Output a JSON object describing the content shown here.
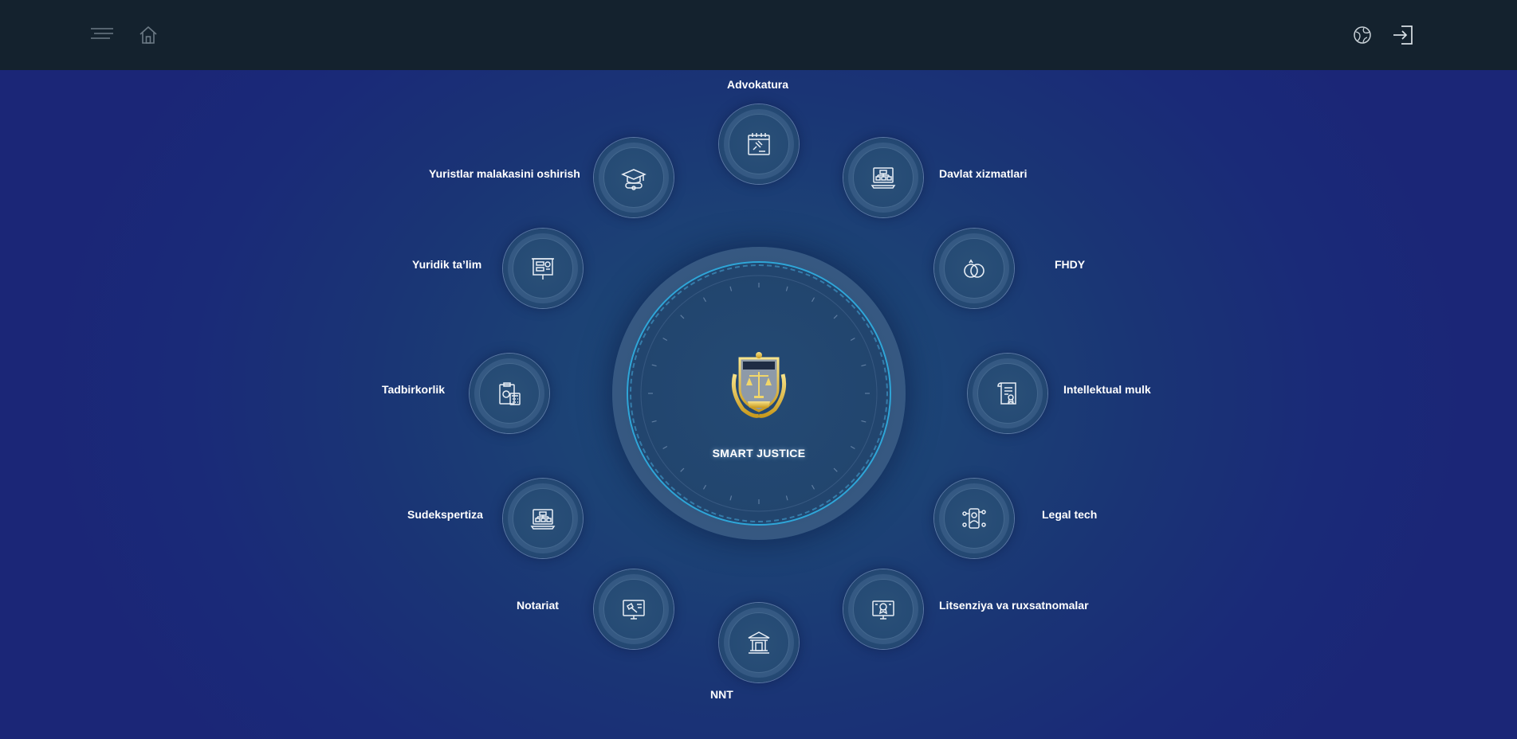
{
  "header": {
    "menu_icon": "hamburger-menu-icon",
    "home_icon": "home-icon",
    "language_icon": "globe-icon",
    "login_icon": "sign-in-icon",
    "background_color": "#14222e"
  },
  "center": {
    "title": "SMART JUSTICE",
    "emblem_icon": "justice-emblem-icon",
    "ring_color": "#2fa6d8"
  },
  "services": [
    {
      "label": "Advokatura",
      "icon": "calendar-gavel-icon"
    },
    {
      "label": "Davlat xizmatlari",
      "icon": "org-chart-laptop-icon"
    },
    {
      "label": "FHDY",
      "icon": "wedding-rings-icon"
    },
    {
      "label": "Intellektual mulk",
      "icon": "certificate-scroll-icon"
    },
    {
      "label": "Legal tech",
      "icon": "phone-network-icon"
    },
    {
      "label": "Litsenziya va ruxsatnomalar",
      "icon": "monitor-badge-icon"
    },
    {
      "label": "NNT",
      "icon": "building-icon"
    },
    {
      "label": "Notariat",
      "icon": "monitor-gavel-icon"
    },
    {
      "label": "Sudekspertiza",
      "icon": "laptop-org-chart-icon"
    },
    {
      "label": "Tadbirkorlik",
      "icon": "clipboard-calculator-icon"
    },
    {
      "label": "Yuridik ta’lim",
      "icon": "presentation-board-icon"
    },
    {
      "label": "Yuristlar malakasini oshirish",
      "icon": "graduation-cap-diploma-icon"
    }
  ],
  "colors": {
    "page_background": "#1a2e6e",
    "label_text": "#ffffff"
  }
}
